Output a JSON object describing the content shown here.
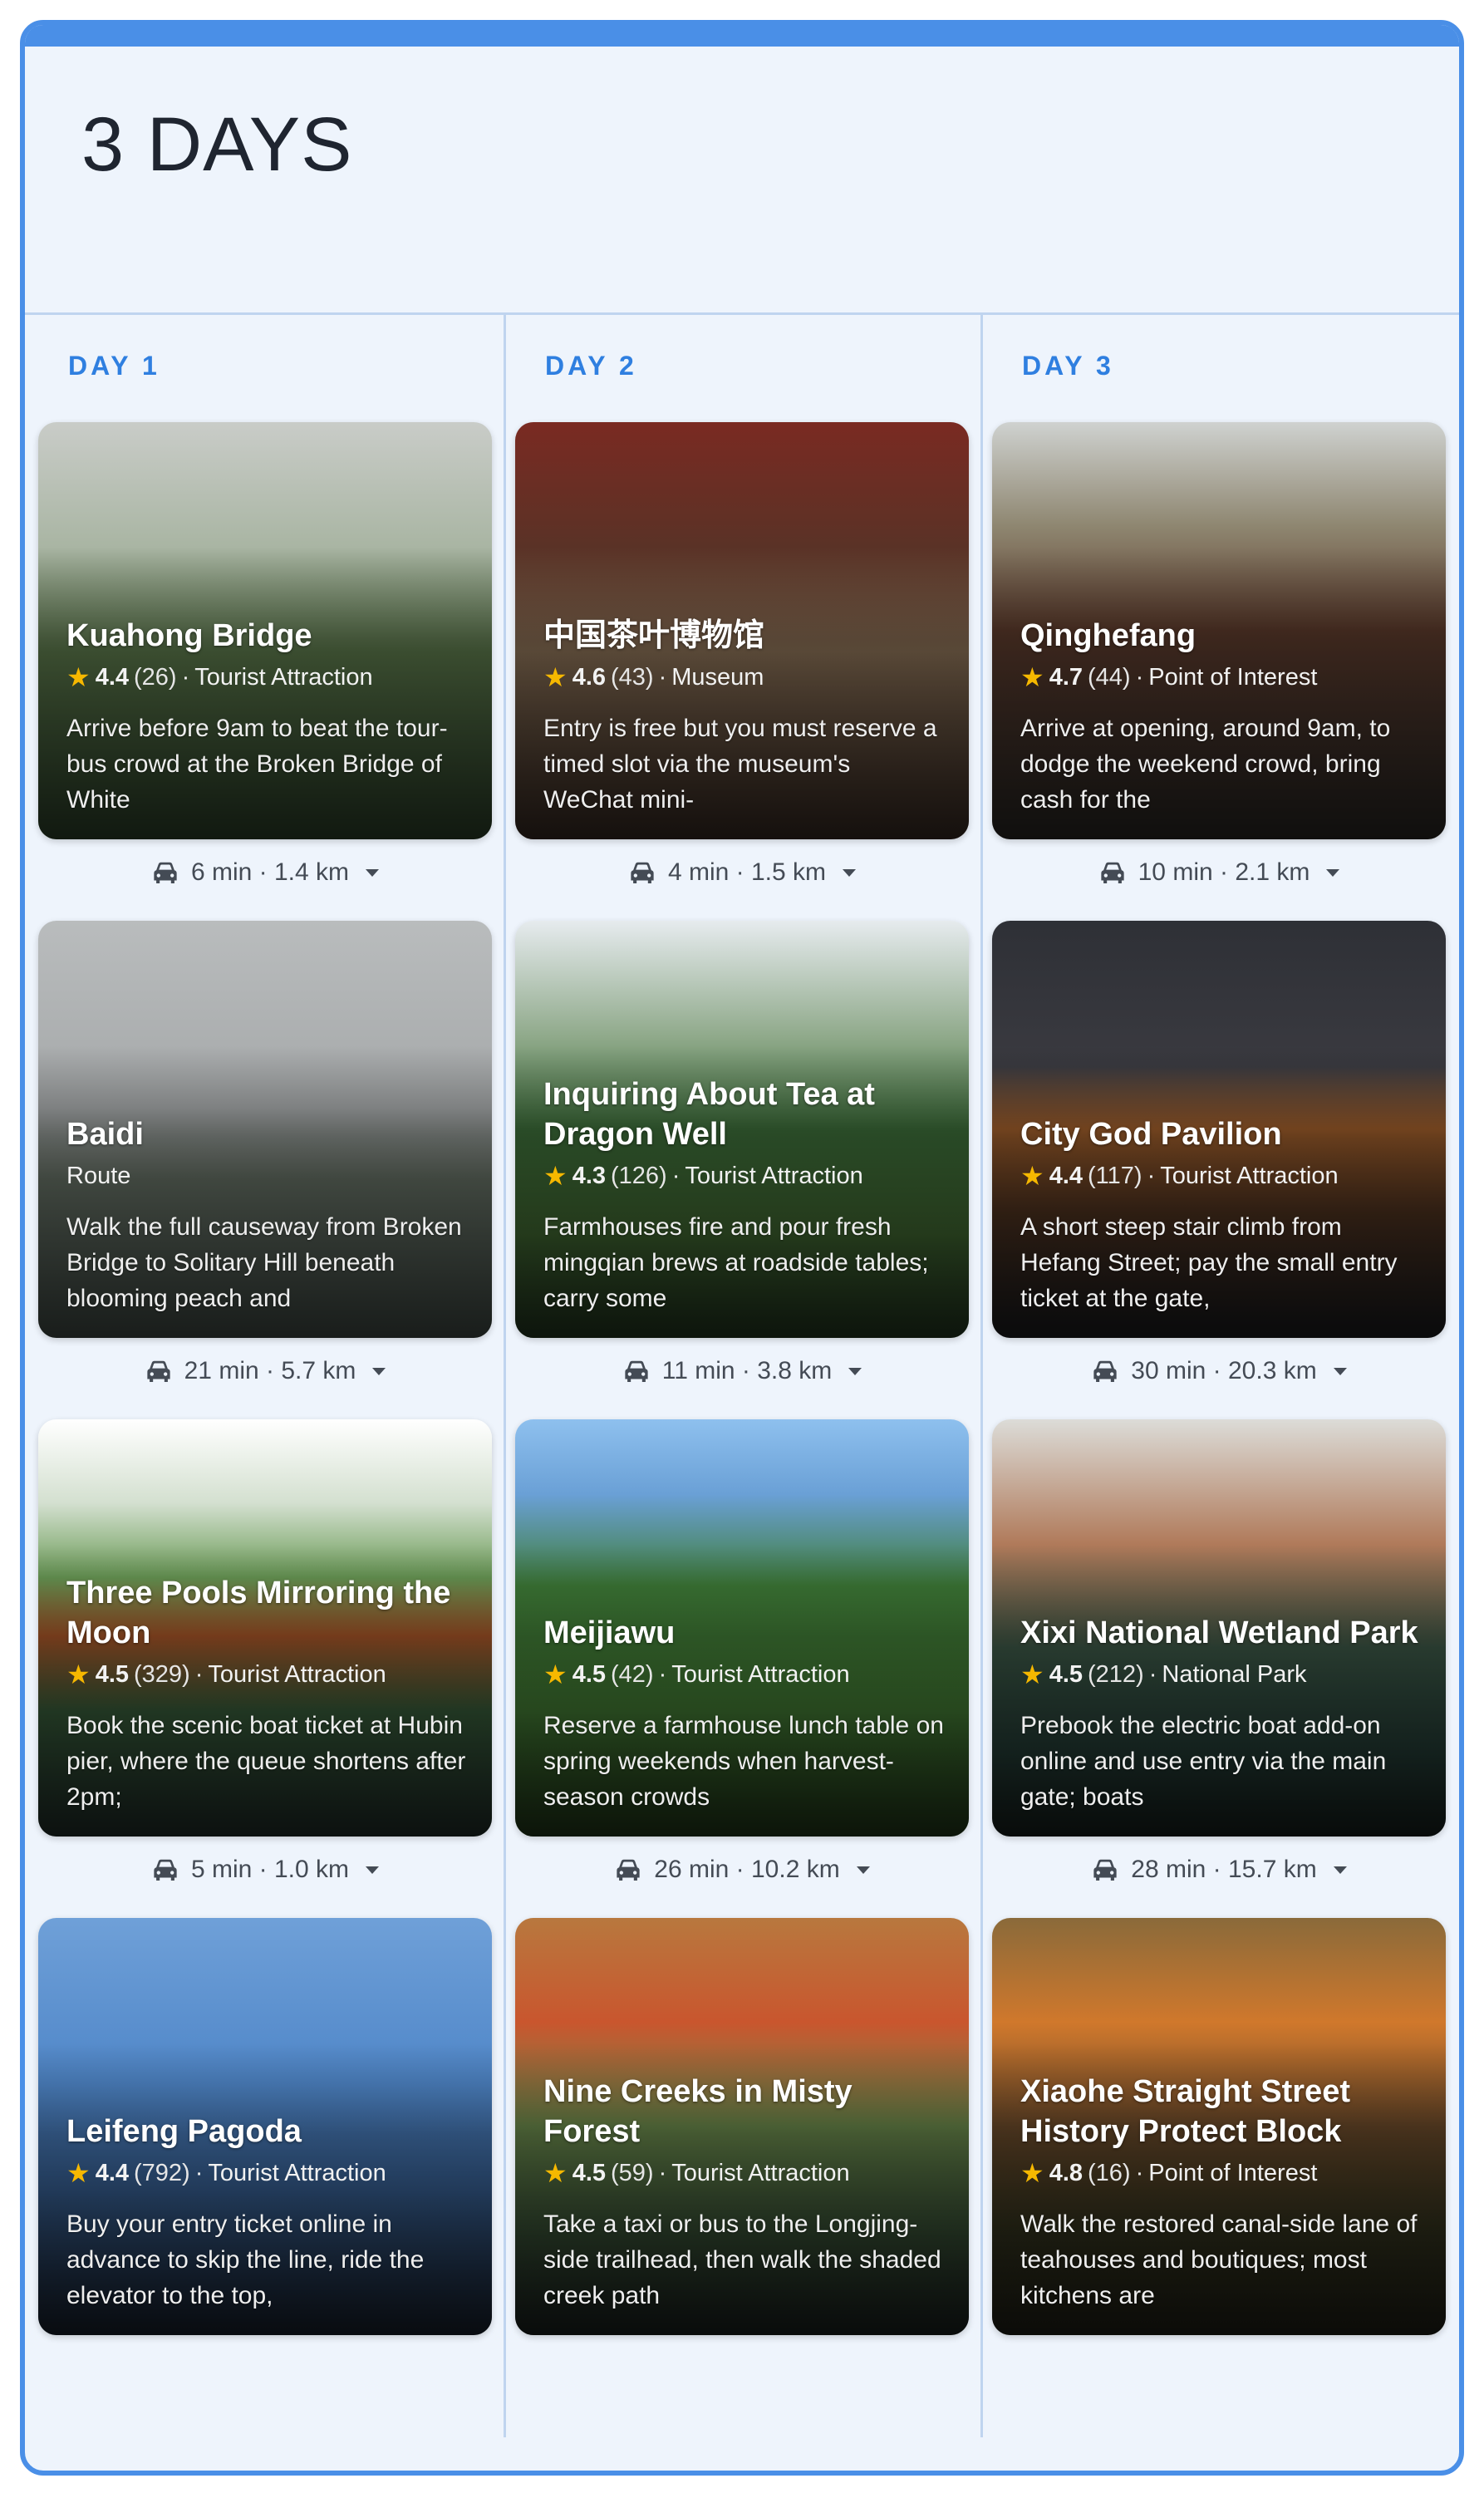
{
  "page_title": "3 DAYS",
  "days": [
    {
      "label": "DAY 1",
      "stops": [
        {
          "name": "Kuahong Bridge",
          "rating": "4.4",
          "count": "(26)",
          "category": "Tourist Attraction",
          "description": "Arrive before 9am to beat the tour-bus crowd at the Broken Bridge of White"
        },
        {
          "name": "Baidi",
          "rating": "",
          "count": "",
          "category": "Route",
          "description": "Walk the full causeway from Broken Bridge to Solitary Hill beneath blooming peach and"
        },
        {
          "name": "Three Pools Mirroring the Moon",
          "rating": "4.5",
          "count": "(329)",
          "category": "Tourist Attraction",
          "description": "Book the scenic boat ticket at Hubin pier, where the queue shortens after 2pm;"
        },
        {
          "name": "Leifeng Pagoda",
          "rating": "4.4",
          "count": "(792)",
          "category": "Tourist Attraction",
          "description": "Buy your entry ticket online in advance to skip the line, ride the elevator to the top,"
        }
      ],
      "transits": [
        "6 min · 1.4 km",
        "21 min · 5.7 km",
        "5 min · 1.0 km"
      ]
    },
    {
      "label": "DAY 2",
      "stops": [
        {
          "name": "中国茶叶博物馆",
          "rating": "4.6",
          "count": "(43)",
          "category": "Museum",
          "description": "Entry is free but you must reserve a timed slot via the museum's WeChat mini-"
        },
        {
          "name": "Inquiring About Tea at Dragon Well",
          "rating": "4.3",
          "count": "(126)",
          "category": "Tourist Attraction",
          "description": "Farmhouses fire and pour fresh mingqian brews at roadside tables; carry some"
        },
        {
          "name": "Meijiawu",
          "rating": "4.5",
          "count": "(42)",
          "category": "Tourist Attraction",
          "description": "Reserve a farmhouse lunch table on spring weekends when harvest-season crowds"
        },
        {
          "name": "Nine Creeks in Misty Forest",
          "rating": "4.5",
          "count": "(59)",
          "category": "Tourist Attraction",
          "description": "Take a taxi or bus to the Longjing-side trailhead, then walk the shaded creek path"
        }
      ],
      "transits": [
        "4 min · 1.5 km",
        "11 min · 3.8 km",
        "26 min · 10.2 km"
      ]
    },
    {
      "label": "DAY 3",
      "stops": [
        {
          "name": "Qinghefang",
          "rating": "4.7",
          "count": "(44)",
          "category": "Point of Interest",
          "description": "Arrive at opening, around 9am, to dodge the weekend crowd, bring cash for the"
        },
        {
          "name": "City God Pavilion",
          "rating": "4.4",
          "count": "(117)",
          "category": "Tourist Attraction",
          "description": "A short steep stair climb from Hefang Street; pay the small entry ticket at the gate,"
        },
        {
          "name": "Xixi National Wetland Park",
          "rating": "4.5",
          "count": "(212)",
          "category": "National Park",
          "description": "Prebook the electric boat add-on online and use entry via the main gate; boats"
        },
        {
          "name": "Xiaohe Straight Street History Protect Block",
          "rating": "4.8",
          "count": "(16)",
          "category": "Point of Interest",
          "description": "Walk the restored canal-side lane of teahouses and boutiques; most kitchens are"
        }
      ],
      "transits": [
        "10 min · 2.1 km",
        "30 min · 20.3 km",
        "28 min · 15.7 km"
      ]
    }
  ],
  "colors": {
    "accent": "#4a8fe7",
    "day_label": "#2f7fe0",
    "star": "#f6b800",
    "panel": "#eef4fc"
  },
  "icons": {
    "transit": "car-icon",
    "expand": "caret-down-icon",
    "rating": "star-icon"
  }
}
